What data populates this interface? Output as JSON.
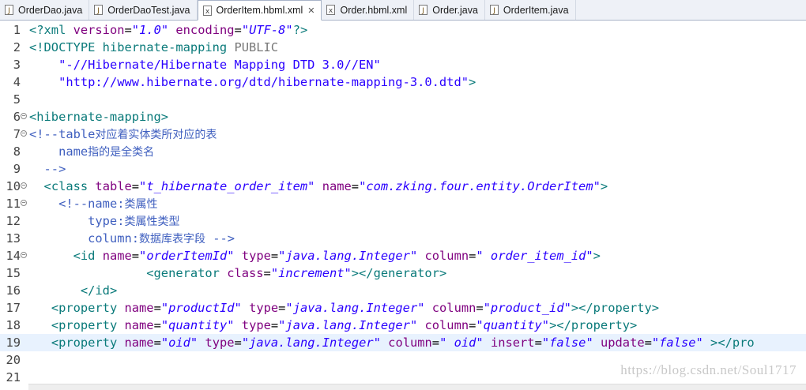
{
  "tabs": [
    {
      "label": "OrderDao.java",
      "icon": "java-file-icon",
      "active": false
    },
    {
      "label": "OrderDaoTest.java",
      "icon": "java-file-icon",
      "active": false
    },
    {
      "label": "OrderItem.hbml.xml",
      "icon": "xml-file-icon",
      "active": true,
      "close": "✕"
    },
    {
      "label": "Order.hbml.xml",
      "icon": "xml-file-icon",
      "active": false
    },
    {
      "label": "Order.java",
      "icon": "java-file-icon",
      "active": false
    },
    {
      "label": "OrderItem.java",
      "icon": "java-file-icon",
      "active": false
    }
  ],
  "colors": {
    "tag": "#0a7a7a",
    "attribute": "#7f007f",
    "value": "#2a00ff",
    "comment": "#3f5fbf",
    "current_line": "#e8f2fe"
  },
  "lines": [
    {
      "n": "1",
      "fold": false,
      "tokens": [
        [
          "tag",
          "<?xml "
        ],
        [
          "attr",
          "version"
        ],
        [
          "plain",
          "="
        ],
        [
          "val",
          "\"1.0\""
        ],
        [
          "plain",
          " "
        ],
        [
          "attr",
          "encoding"
        ],
        [
          "plain",
          "="
        ],
        [
          "val",
          "\"UTF-8\""
        ],
        [
          "tag",
          "?>"
        ]
      ]
    },
    {
      "n": "2",
      "fold": false,
      "tokens": [
        [
          "tag",
          "<!DOCTYPE "
        ],
        [
          "tag",
          "hibernate-mapping "
        ],
        [
          "kw",
          "PUBLIC"
        ]
      ]
    },
    {
      "n": "3",
      "fold": false,
      "tokens": [
        [
          "plain",
          "    "
        ],
        [
          "str",
          "\"-//Hibernate/Hibernate Mapping DTD 3.0//EN\""
        ]
      ]
    },
    {
      "n": "4",
      "fold": false,
      "tokens": [
        [
          "plain",
          "    "
        ],
        [
          "str",
          "\"http://www.hibernate.org/dtd/hibernate-mapping-3.0.dtd\""
        ],
        [
          "tag",
          ">"
        ]
      ]
    },
    {
      "n": "5",
      "fold": false,
      "tokens": []
    },
    {
      "n": "6",
      "fold": true,
      "tokens": [
        [
          "tag",
          "<hibernate-mapping>"
        ]
      ]
    },
    {
      "n": "7",
      "fold": true,
      "tokens": [
        [
          "com",
          "<!--table"
        ],
        [
          "comcn",
          "对应着实体类所对应的表"
        ]
      ]
    },
    {
      "n": "8",
      "fold": false,
      "tokens": [
        [
          "com",
          "    name"
        ],
        [
          "comcn",
          "指的是全类名"
        ]
      ]
    },
    {
      "n": "9",
      "fold": false,
      "tokens": [
        [
          "com",
          "  -->"
        ]
      ]
    },
    {
      "n": "10",
      "fold": true,
      "tokens": [
        [
          "plain",
          "  "
        ],
        [
          "tag",
          "<class "
        ],
        [
          "attr",
          "table"
        ],
        [
          "plain",
          "="
        ],
        [
          "val",
          "\"t_hibernate_order_item\""
        ],
        [
          "plain",
          " "
        ],
        [
          "attr",
          "name"
        ],
        [
          "plain",
          "="
        ],
        [
          "val",
          "\"com.zking.four.entity.OrderItem\""
        ],
        [
          "tag",
          ">"
        ]
      ]
    },
    {
      "n": "11",
      "fold": true,
      "tokens": [
        [
          "plain",
          "    "
        ],
        [
          "com",
          "<!--name:"
        ],
        [
          "comcn",
          "类属性"
        ]
      ]
    },
    {
      "n": "12",
      "fold": false,
      "tokens": [
        [
          "com",
          "        type:"
        ],
        [
          "comcn",
          "类属性类型"
        ]
      ]
    },
    {
      "n": "13",
      "fold": false,
      "tokens": [
        [
          "com",
          "        column:"
        ],
        [
          "comcn",
          "数据库表字段"
        ],
        [
          "com",
          " -->"
        ]
      ]
    },
    {
      "n": "14",
      "fold": true,
      "tokens": [
        [
          "plain",
          "      "
        ],
        [
          "tag",
          "<id "
        ],
        [
          "attr",
          "name"
        ],
        [
          "plain",
          "="
        ],
        [
          "val",
          "\"orderItemId\""
        ],
        [
          "plain",
          " "
        ],
        [
          "attr",
          "type"
        ],
        [
          "plain",
          "="
        ],
        [
          "val",
          "\"java.lang.Integer\""
        ],
        [
          "plain",
          " "
        ],
        [
          "attr",
          "column"
        ],
        [
          "plain",
          "="
        ],
        [
          "val",
          "\" order_item_id\""
        ],
        [
          "tag",
          ">"
        ]
      ]
    },
    {
      "n": "15",
      "fold": false,
      "tokens": [
        [
          "plain",
          "                "
        ],
        [
          "tag",
          "<generator "
        ],
        [
          "attr",
          "class"
        ],
        [
          "plain",
          "="
        ],
        [
          "val",
          "\"increment\""
        ],
        [
          "tag",
          "></generator>"
        ]
      ]
    },
    {
      "n": "16",
      "fold": false,
      "tokens": [
        [
          "plain",
          "       "
        ],
        [
          "tag",
          "</id>"
        ]
      ]
    },
    {
      "n": "17",
      "fold": false,
      "tokens": [
        [
          "plain",
          "   "
        ],
        [
          "tag",
          "<property "
        ],
        [
          "attr",
          "name"
        ],
        [
          "plain",
          "="
        ],
        [
          "val",
          "\"productId\""
        ],
        [
          "plain",
          " "
        ],
        [
          "attr",
          "type"
        ],
        [
          "plain",
          "="
        ],
        [
          "val",
          "\"java.lang.Integer\""
        ],
        [
          "plain",
          " "
        ],
        [
          "attr",
          "column"
        ],
        [
          "plain",
          "="
        ],
        [
          "val",
          "\"product_id\""
        ],
        [
          "tag",
          "></property>"
        ]
      ]
    },
    {
      "n": "18",
      "fold": false,
      "tokens": [
        [
          "plain",
          "   "
        ],
        [
          "tag",
          "<property "
        ],
        [
          "attr",
          "name"
        ],
        [
          "plain",
          "="
        ],
        [
          "val",
          "\"quantity\""
        ],
        [
          "plain",
          " "
        ],
        [
          "attr",
          "type"
        ],
        [
          "plain",
          "="
        ],
        [
          "val",
          "\"java.lang.Integer\""
        ],
        [
          "plain",
          " "
        ],
        [
          "attr",
          "column"
        ],
        [
          "plain",
          "="
        ],
        [
          "val",
          "\"quantity\""
        ],
        [
          "tag",
          "></property>"
        ]
      ]
    },
    {
      "n": "19",
      "fold": false,
      "cur": true,
      "tokens": [
        [
          "plain",
          "   "
        ],
        [
          "tag",
          "<property "
        ],
        [
          "attr",
          "name"
        ],
        [
          "plain",
          "="
        ],
        [
          "val",
          "\"oid\""
        ],
        [
          "plain",
          " "
        ],
        [
          "attr",
          "type"
        ],
        [
          "plain",
          "="
        ],
        [
          "val",
          "\"java.lang.Integer\""
        ],
        [
          "plain",
          " "
        ],
        [
          "attr",
          "column"
        ],
        [
          "plain",
          "="
        ],
        [
          "val",
          "\" oid\""
        ],
        [
          "plain",
          " "
        ],
        [
          "attr",
          "insert"
        ],
        [
          "plain",
          "="
        ],
        [
          "val",
          "\"false\""
        ],
        [
          "plain",
          " "
        ],
        [
          "attr",
          "update"
        ],
        [
          "plain",
          "="
        ],
        [
          "val",
          "\"false\""
        ],
        [
          "plain",
          " "
        ],
        [
          "tag",
          "></pro"
        ]
      ]
    },
    {
      "n": "20",
      "fold": false,
      "tokens": []
    },
    {
      "n": "21",
      "fold": false,
      "tokens": []
    }
  ],
  "watermark": "https://blog.csdn.net/Soul1717"
}
